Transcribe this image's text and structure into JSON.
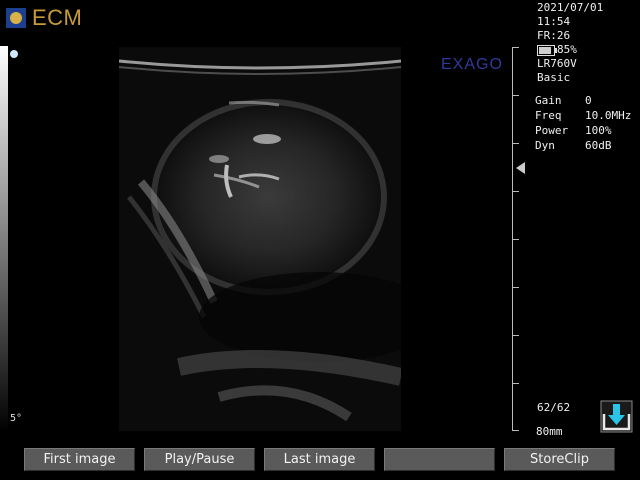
{
  "header": {
    "logo_text": "ECM"
  },
  "status": {
    "date": "2021/07/01",
    "time": "11:54",
    "frame_rate": "FR:26",
    "battery": "85%",
    "battery_level": 0.85,
    "probe": "LR760V",
    "preset": "Basic"
  },
  "params": [
    {
      "label": "Gain",
      "value": "0"
    },
    {
      "label": "Freq",
      "value": "10.0MHz"
    },
    {
      "label": "Power",
      "value": "100%"
    },
    {
      "label": "Dyn",
      "value": "60dB"
    }
  ],
  "image": {
    "brand": "EXAGO",
    "angle": "5°"
  },
  "footer_info": {
    "frames": "62/62",
    "depth": "80mm"
  },
  "toolbar": {
    "first_image": "First image",
    "play_pause": "Play/Pause",
    "last_image": "Last image",
    "blank": "",
    "store_clip": "StoreClip"
  },
  "colors": {
    "logo_blue": "#1c3f8f",
    "logo_gold": "#c79a3a",
    "save_icon": "#29c4e8"
  }
}
